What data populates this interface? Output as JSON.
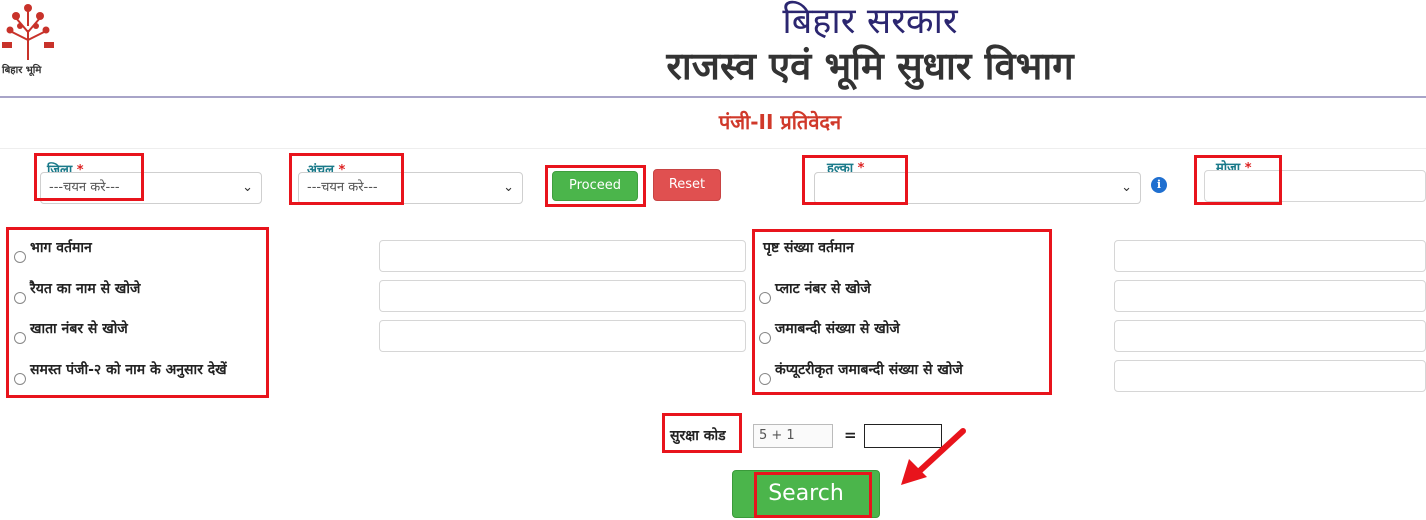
{
  "header": {
    "logo_text": "बिहार भूमि",
    "title_top": "बिहार सरकार",
    "title_main": "राजस्व एवं भूमि सुधार विभाग",
    "subtitle": "पंजी-II प्रतिवेदन"
  },
  "filters": {
    "district": {
      "label": "जिला",
      "required_mark": "*",
      "value": "---चयन करे---"
    },
    "circle": {
      "label": "अंचल",
      "required_mark": "*",
      "value": "---चयन करे---"
    },
    "proceed_label": "Proceed",
    "reset_label": "Reset",
    "halka": {
      "label": "हल्का",
      "required_mark": "*",
      "value": ""
    },
    "mauja": {
      "label": "मोजा",
      "required_mark": "*",
      "value": ""
    }
  },
  "search_options": {
    "left": [
      {
        "label": "भाग वर्तमान",
        "selected": false
      },
      {
        "label": "रैयत का नाम से खोजे",
        "selected": false
      },
      {
        "label": "खाता नंबर से खोजे",
        "selected": false
      },
      {
        "label": "समस्त पंजी-२ को नाम के अनुसार देखें",
        "selected": false
      }
    ],
    "right": [
      {
        "label": "पृष्ट संख्या वर्तमान",
        "selected": false
      },
      {
        "label": "प्लाट नंबर से खोजे",
        "selected": false
      },
      {
        "label": "जमाबन्दी संख्या से खोजे",
        "selected": false
      },
      {
        "label": "कंप्यूटरीकृत जमाबन्दी संख्या से खोजे",
        "selected": false
      }
    ]
  },
  "captcha": {
    "label": "सुरक्षा कोड",
    "question": "5 + 1",
    "equals": "=",
    "answer": ""
  },
  "search_label": "Search",
  "colors": {
    "annotation_red": "#e8141c",
    "button_green": "#4bb54b",
    "button_red": "#e05050",
    "title_blue": "#2b2670",
    "subtitle_red": "#d0392a",
    "label_teal": "#1a7a8a"
  }
}
